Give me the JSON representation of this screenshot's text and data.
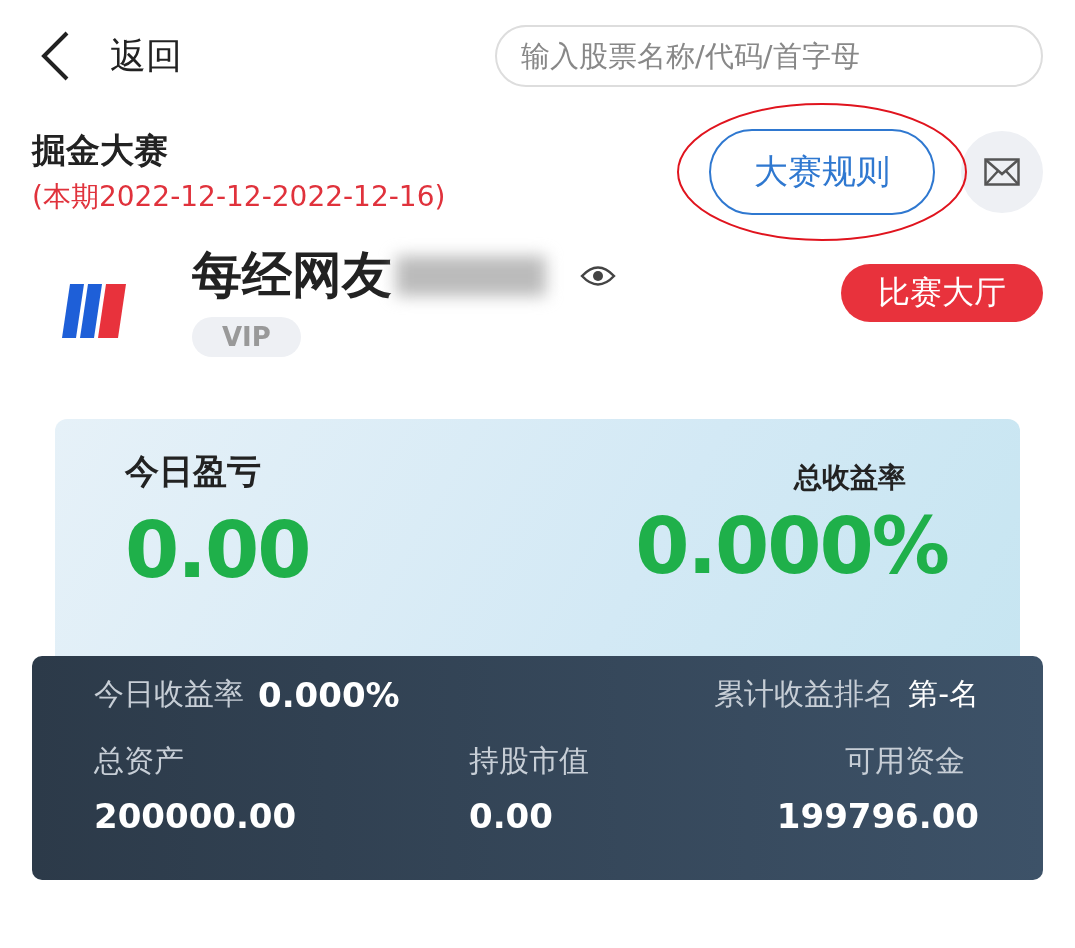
{
  "top_bar": {
    "back_label": "返回",
    "search": {
      "placeholder": "输入股票名称/代码/首字母"
    }
  },
  "contest": {
    "title": "掘金大赛",
    "period": "(本期2022-12-12-2022-12-16)",
    "rules_button": "大赛规则",
    "rules_highlighted": true
  },
  "user": {
    "name": "每经网友",
    "name_obscured": true,
    "badge": "VIP",
    "hall_button": "比赛大厅"
  },
  "summary": {
    "today_label": "今日盈亏",
    "today_value": "0.00",
    "total_label": "总收益率",
    "total_value": "0.000%"
  },
  "stats": {
    "today_rate_label": "今日收益率",
    "today_rate_value": "0.000%",
    "rank_label": "累计收益排名",
    "rank_value": "第-名",
    "items": [
      {
        "label": "总资产",
        "value": "200000.00"
      },
      {
        "label": "持股市值",
        "value": "0.00"
      },
      {
        "label": "可用资金",
        "value": "199796.00"
      }
    ]
  }
}
